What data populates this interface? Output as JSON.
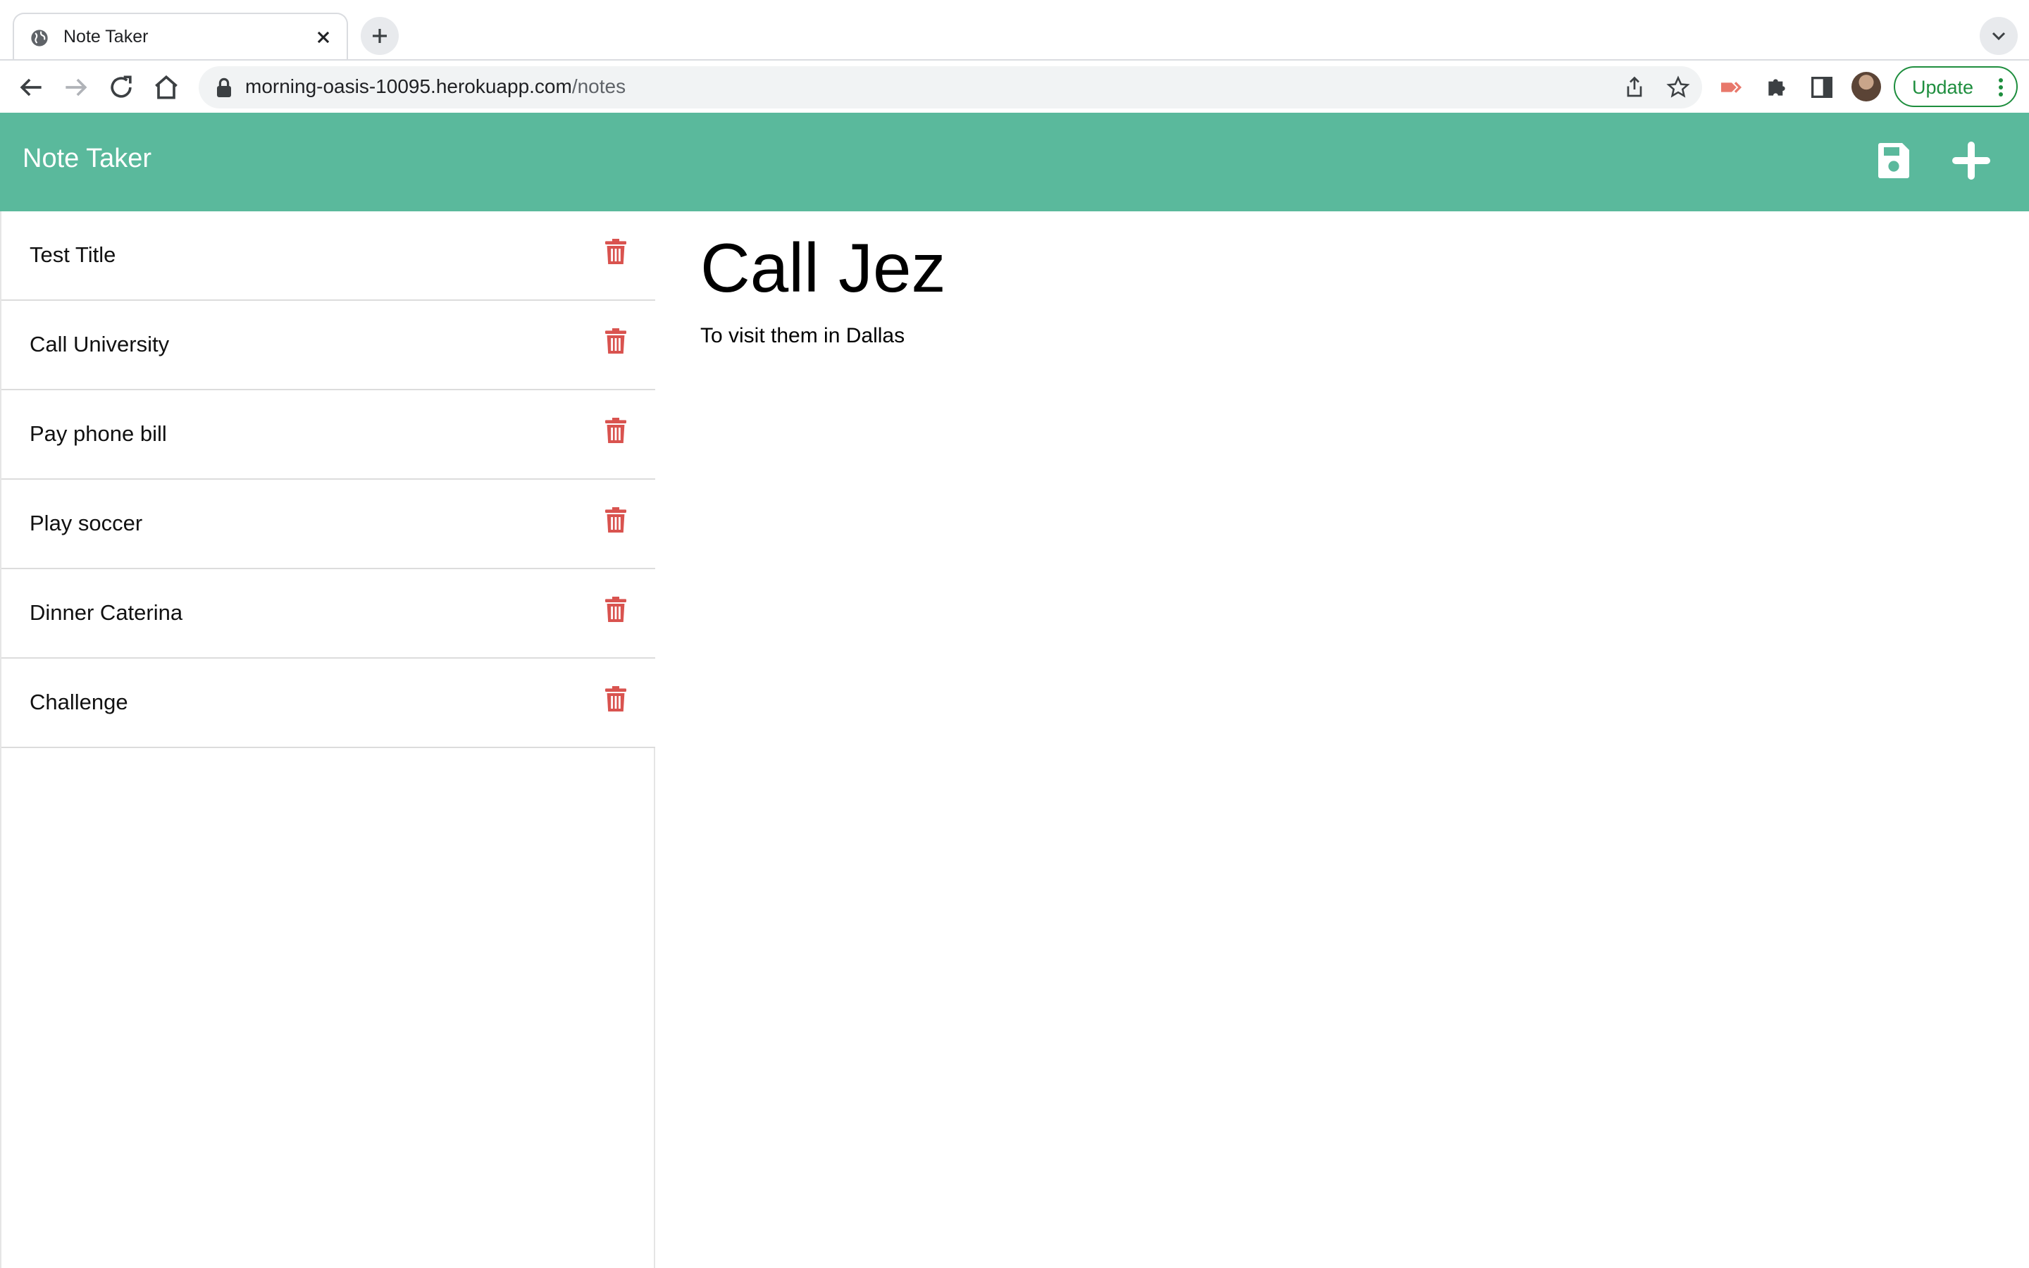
{
  "browser": {
    "tab_title": "Note Taker",
    "url_host": "morning-oasis-10095.herokuapp.com",
    "url_path": "/notes",
    "update_label": "Update"
  },
  "app": {
    "title": "Note Taker",
    "accent_color": "#5ab99c",
    "delete_color": "#d9534f"
  },
  "notes": [
    {
      "title": "Test Title"
    },
    {
      "title": "Call University"
    },
    {
      "title": "Pay phone bill"
    },
    {
      "title": "Play soccer"
    },
    {
      "title": "Dinner Caterina"
    },
    {
      "title": "Challenge"
    }
  ],
  "active_note": {
    "title": "Call Jez",
    "text": "To visit them in Dallas"
  }
}
